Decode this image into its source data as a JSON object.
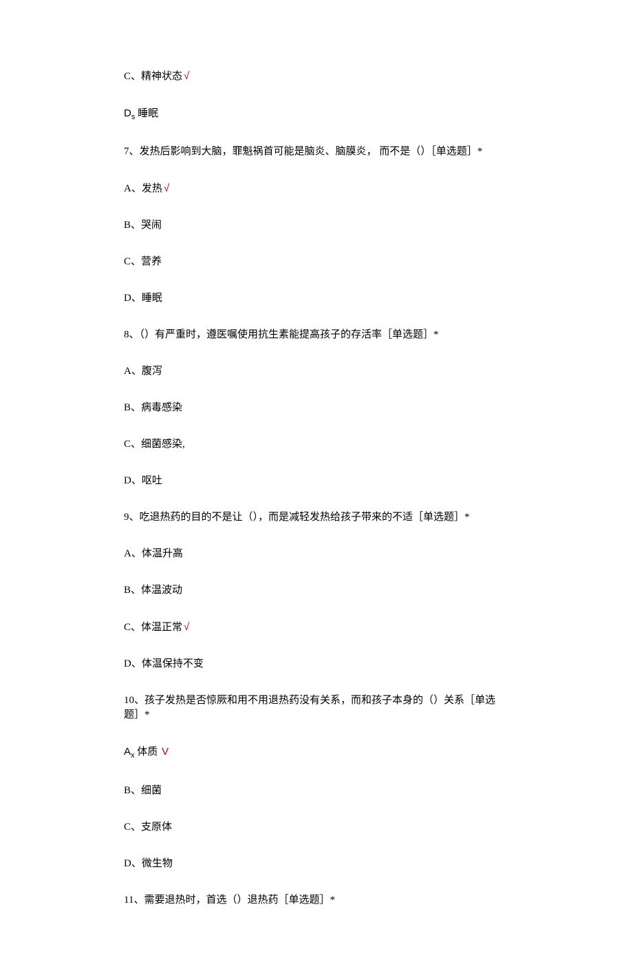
{
  "lines": [
    {
      "prefix": "C、",
      "text": "精神状态",
      "mark": "√"
    },
    {
      "prefix": "D",
      "sub": "s",
      "text": "睡眠"
    },
    {
      "prefix": "7、",
      "text": "发热后影响到大脑，罪魁祸首可能是脑炎、脑膜炎， 而不是（）［单选题］*"
    },
    {
      "prefix": "A、",
      "text": "发热",
      "mark": "√"
    },
    {
      "prefix": "B、",
      "text": "哭闹"
    },
    {
      "prefix": "C、",
      "text": "营养"
    },
    {
      "prefix": "D、",
      "text": "睡眠"
    },
    {
      "prefix": "8、",
      "text": "（）有严重时，遵医嘱使用抗生素能提高孩子的存活率［单选题］*"
    },
    {
      "prefix": "A、",
      "text": "腹泻"
    },
    {
      "prefix": "B、",
      "text": "病毒感染"
    },
    {
      "prefix": "C、",
      "text": "细菌感染,"
    },
    {
      "prefix": "D、",
      "text": "呕吐"
    },
    {
      "prefix": "9、",
      "text": "吃退热药的目的不是让（），而是减轻发热给孩子带来的不适［单选题］*"
    },
    {
      "prefix": "A、",
      "text": "体温升高"
    },
    {
      "prefix": "B、",
      "text": "体温波动"
    },
    {
      "prefix": "C、",
      "text": "体温正常",
      "mark": "√"
    },
    {
      "prefix": "D、",
      "text": "体温保持不变"
    },
    {
      "prefix": "10、",
      "text": "孩子发热是否惊厥和用不用退热药没有关系，而和孩子本身的（）关系［单选题］*"
    },
    {
      "prefix": "A",
      "sub": "x",
      "text": "体质",
      "mark": "V"
    },
    {
      "prefix": "B、",
      "text": "细菌"
    },
    {
      "prefix": "C、",
      "text": "支原体"
    },
    {
      "prefix": "D、",
      "text": "微生物"
    },
    {
      "prefix": "11、",
      "text": "需要退热时，首选（）退热药［单选题］*"
    }
  ]
}
